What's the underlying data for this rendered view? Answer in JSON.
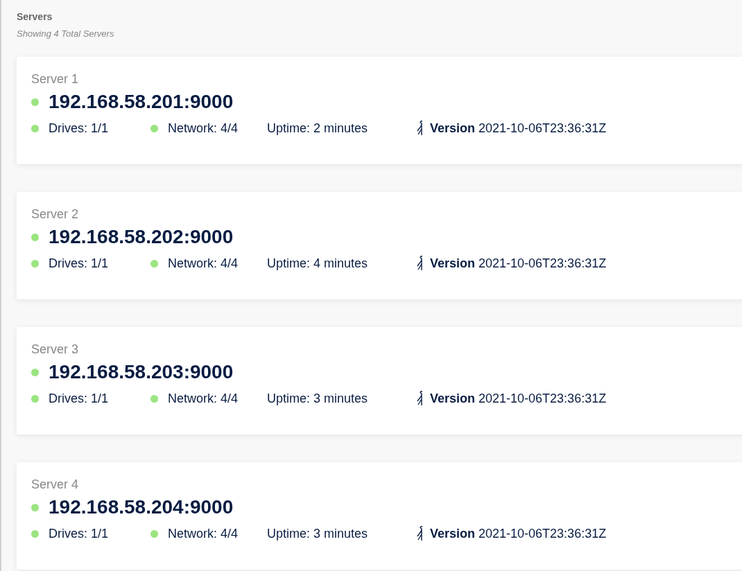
{
  "header": {
    "title": "Servers",
    "subtitle": "Showing 4 Total Servers"
  },
  "servers": [
    {
      "name": "Server 1",
      "address": "192.168.58.201:9000",
      "color": "#9be480",
      "drives": {
        "text": "Drives: 1/1",
        "color": "#9be480"
      },
      "network": {
        "text": "Network: 4/4",
        "color": "#9be480"
      },
      "uptime": "Uptime: 2 minutes",
      "version": "**Version** 2021-10-06T23:36:31Z"
    },
    {
      "name": "Server 2",
      "address": "192.168.58.202:9000",
      "color": "#9be480",
      "drives": {
        "text": "Drives: 1/1",
        "color": "#9be480"
      },
      "network": {
        "text": "Network: 4/4",
        "color": "#9be480"
      },
      "uptime": "Uptime: 4 minutes",
      "version": "**Version** 2021-10-06T23:36:31Z"
    },
    {
      "name": "Server 3",
      "address": "192.168.58.203:9000",
      "color": "#9be480",
      "drives": {
        "text": "Drives: 1/1",
        "color": "#9be480"
      },
      "network": {
        "text": "Network: 4/4",
        "color": "#9be480"
      },
      "uptime": "Uptime: 3 minutes",
      "version": "**Version** 2021-10-06T23:36:31Z"
    },
    {
      "name": "Server 4",
      "address": "192.168.58.204:9000",
      "color": "#9be480",
      "drives": {
        "text": "Drives: 1/1",
        "color": "#9be480"
      },
      "network": {
        "text": "Network: 4/4",
        "color": "#9be480"
      },
      "uptime": "Uptime: 3 minutes",
      "version": "**Version** 2021-10-06T23:36:31Z"
    }
  ]
}
